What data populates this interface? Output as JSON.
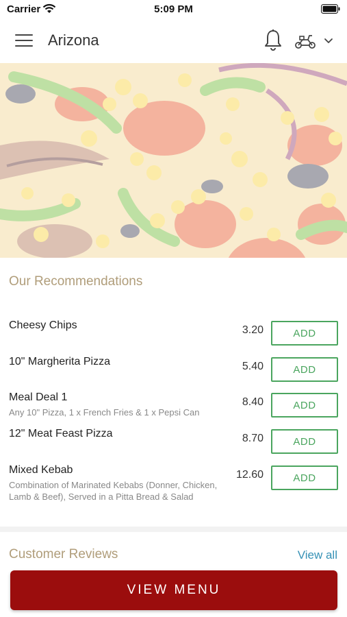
{
  "status_bar": {
    "carrier": "Carrier",
    "time": "5:09 PM"
  },
  "header": {
    "title": "Arizona",
    "icons": [
      "menu-icon",
      "bell-icon",
      "scooter-icon",
      "chevron-down-icon"
    ]
  },
  "recommendations": {
    "title": "Our Recommendations",
    "add_label": "ADD",
    "items": [
      {
        "name": "Cheesy Chips",
        "desc": "",
        "price": "3.20"
      },
      {
        "name": "10\" Margherita Pizza",
        "desc": "",
        "price": "5.40"
      },
      {
        "name": "Meal Deal 1",
        "desc": "Any 10\" Pizza, 1 x French Fries & 1 x Pepsi Can",
        "price": "8.40"
      },
      {
        "name": "12\" Meat Feast Pizza",
        "desc": "",
        "price": "8.70"
      },
      {
        "name": "Mixed Kebab",
        "desc": "Combination of Marinated Kebabs  (Donner, Chicken, Lamb & Beef),  Served in a Pitta Bread & Salad",
        "price": "12.60"
      }
    ]
  },
  "reviews": {
    "title": "Customer Reviews",
    "view_all": "View all"
  },
  "footer": {
    "view_menu": "VIEW MENU"
  },
  "colors": {
    "accent_green": "#4aa55e",
    "section_title": "#b09d7a",
    "link_blue": "#3591b5",
    "primary_button": "#9b0d0d"
  }
}
